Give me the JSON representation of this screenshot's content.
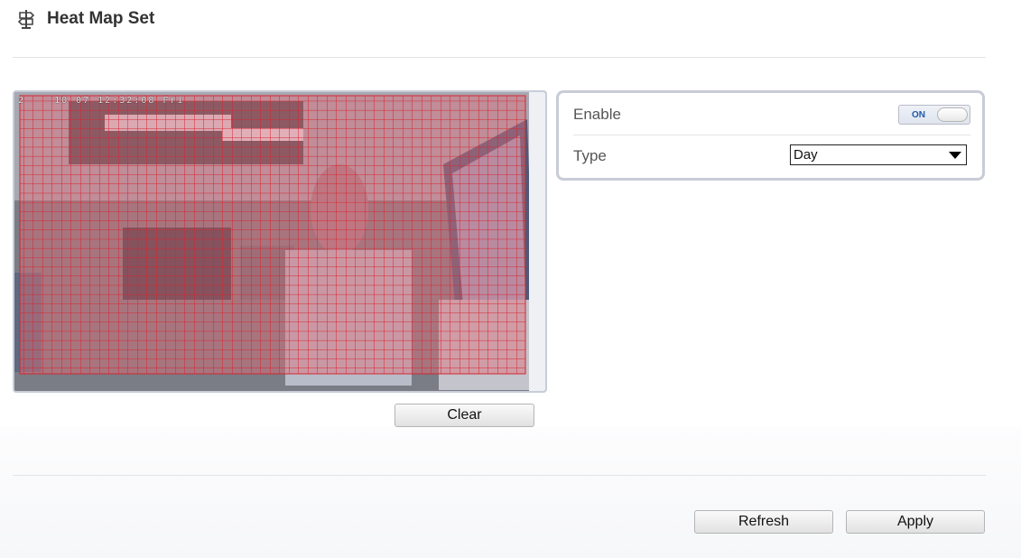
{
  "header": {
    "title": "Heat Map Set",
    "icon": "signpost-icon"
  },
  "video": {
    "timestamp": "2    10 07 12:32:08 Fri",
    "grid_color": "#d8242e",
    "overlay_color": "#e06c78"
  },
  "buttons": {
    "clear_label": "Clear",
    "refresh_label": "Refresh",
    "apply_label": "Apply"
  },
  "settings": {
    "enable_label": "Enable",
    "enable_state": "ON",
    "type_label": "Type",
    "type_value": "Day"
  }
}
